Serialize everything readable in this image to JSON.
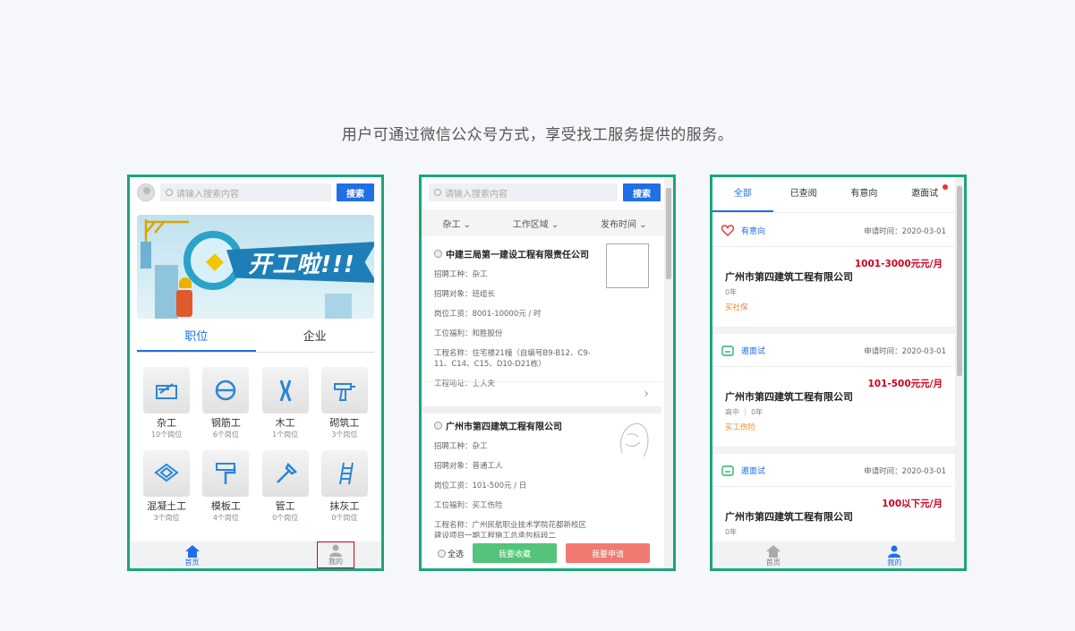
{
  "caption": "用户可通过微信公众号方式，享受找工服务提供的服务。",
  "colors": {
    "frame": "#1aa67a",
    "primary": "#1f6fe6",
    "salary": "#d2001c",
    "benefit": "#f08a28"
  },
  "phone1": {
    "search_placeholder": "请输入搜索内容",
    "search_button": "搜索",
    "banner_text": "开工啦!!!",
    "tabs": [
      "职位",
      "企业"
    ],
    "categories": [
      {
        "name": "杂工",
        "count": "10个岗位",
        "icon": "saw-icon"
      },
      {
        "name": "钢筋工",
        "count": "6个岗位",
        "icon": "rebar-icon"
      },
      {
        "name": "木工",
        "count": "1个岗位",
        "icon": "pliers-icon"
      },
      {
        "name": "砌筑工",
        "count": "3个岗位",
        "icon": "drill-icon"
      },
      {
        "name": "混凝土工",
        "count": "3个岗位",
        "icon": "concrete-icon"
      },
      {
        "name": "模板工",
        "count": "4个岗位",
        "icon": "roller-icon"
      },
      {
        "name": "管工",
        "count": "0个岗位",
        "icon": "wrench-icon"
      },
      {
        "name": "抹灰工",
        "count": "0个岗位",
        "icon": "ladder-icon"
      }
    ],
    "nav": {
      "home": "首页",
      "mine": "我的"
    }
  },
  "phone2": {
    "search_placeholder": "请输入搜索内容",
    "search_button": "搜索",
    "filters": [
      "杂工",
      "工作区域",
      "发布时间"
    ],
    "jobs": [
      {
        "company": "中建三局第一建设工程有限责任公司",
        "lines": [
          "招聘工种：杂工",
          "招聘对象：班组长",
          "岗位工资：8001-10000元 / 时",
          "工位福利：和胜股份",
          "工程名称：住宅楼21幢（自编号B9-B12、C9-11、C14、C15、D10-D21栋）",
          "工程地址：士大夫"
        ]
      },
      {
        "company": "广州市第四建筑工程有限公司",
        "lines": [
          "招聘工种：杂工",
          "招聘对象：普通工人",
          "岗位工资：101-500元 / 日",
          "工位福利：买工伤险",
          "工程名称：广州民航职业技术学院花都新校区建设项目一期工程施工总承包标段二"
        ]
      }
    ],
    "select_all": "全选",
    "collect_button": "我要收藏",
    "apply_button": "我要申请"
  },
  "phone3": {
    "tabs": [
      "全部",
      "已查阅",
      "有意向",
      "邀面试"
    ],
    "applications": [
      {
        "status": "有意向",
        "time": "申请时间：2020-03-01",
        "salary": "1001-3000元元/月",
        "company": "广州市第四建筑工程有限公司",
        "meta": "0年",
        "benefit": "买社保"
      },
      {
        "status": "邀面试",
        "time": "申请时间：2020-03-01",
        "salary": "101-500元元/月",
        "company": "广州市第四建筑工程有限公司",
        "meta": "高中 ｜ 0年",
        "benefit": "买工伤险"
      },
      {
        "status": "邀面试",
        "time": "申请时间：2020-03-01",
        "salary": "100以下元/月",
        "company": "广州市第四建筑工程有限公司",
        "meta": "0年",
        "benefit": ""
      }
    ],
    "nav": {
      "home": "首页",
      "mine": "我的"
    }
  }
}
